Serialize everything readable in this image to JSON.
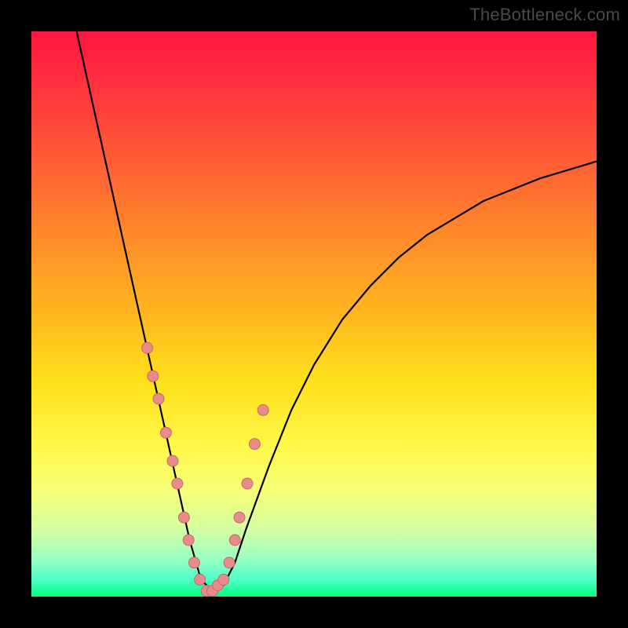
{
  "watermark": "TheBottleneck.com",
  "chart_data": {
    "type": "line",
    "title": "",
    "xlabel": "",
    "ylabel": "",
    "xlim": [
      0,
      100
    ],
    "ylim": [
      0,
      100
    ],
    "note": "Axes are unlabeled; shape is a V-curve bottoming near x≈30 against a red→green vertical gradient.",
    "series": [
      {
        "name": "curve",
        "x": [
          8,
          10,
          12,
          14,
          16,
          18,
          20,
          22,
          24,
          26,
          28,
          30,
          32,
          34,
          36,
          38,
          42,
          46,
          50,
          55,
          60,
          65,
          70,
          75,
          80,
          85,
          90,
          95,
          100
        ],
        "y": [
          100,
          91,
          82,
          73,
          64,
          55,
          46,
          37,
          28,
          19,
          10,
          3,
          1,
          2,
          6,
          12,
          23,
          33,
          41,
          49,
          55,
          60,
          64,
          67,
          70,
          72,
          74,
          75.5,
          77
        ]
      }
    ],
    "markers": {
      "name": "highlighted-points",
      "x": [
        20.5,
        21.5,
        22.5,
        23.8,
        25.0,
        25.8,
        27.0,
        27.8,
        28.8,
        29.8,
        31.0,
        32.0,
        33.0,
        34.0,
        35.0,
        36.0,
        36.8,
        38.2,
        39.5,
        41.0
      ],
      "y": [
        44,
        39,
        35,
        29,
        24,
        20,
        14,
        10,
        6,
        3,
        1,
        1,
        2,
        3,
        6,
        10,
        14,
        20,
        27,
        33
      ]
    },
    "marker_style": {
      "fill": "#e98b8b",
      "stroke": "#c46a6a",
      "radius_px": 7
    },
    "gradient_stops": [
      {
        "pos": 0.0,
        "color": "#ff163f"
      },
      {
        "pos": 0.22,
        "color": "#ff5a36"
      },
      {
        "pos": 0.5,
        "color": "#ffb71e"
      },
      {
        "pos": 0.74,
        "color": "#fff94d"
      },
      {
        "pos": 0.93,
        "color": "#9fffc0"
      },
      {
        "pos": 1.0,
        "color": "#00ff7f"
      }
    ]
  }
}
